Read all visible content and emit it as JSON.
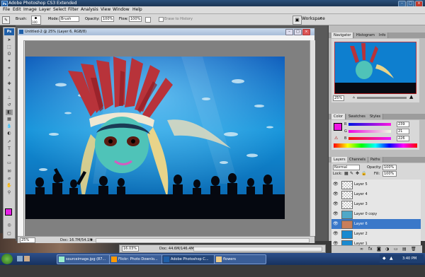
{
  "window": {
    "title": "Adobe Photoshop CS3 Extended"
  },
  "menu": [
    "File",
    "Edit",
    "Image",
    "Layer",
    "Select",
    "Filter",
    "Analysis",
    "View",
    "Window",
    "Help"
  ],
  "options": {
    "brush_label": "Brush:",
    "brush_size": "100",
    "mode_label": "Mode:",
    "mode_value": "Brush",
    "opacity_label": "Opacity:",
    "opacity_value": "100%",
    "flow_label": "Flow:",
    "flow_value": "100%",
    "erase_history": "Erase to History",
    "workspace": "Workspace"
  },
  "document": {
    "title": "Untitled-2 @ 25% (Layer 6, RGB/8)",
    "zoom": "25%",
    "doc_info": "Doc: 16.7M/54.1M"
  },
  "document2": {
    "zoom": "16.03%",
    "doc_info": "Doc: 44.6M/146.4M"
  },
  "navigator": {
    "tabs": [
      "Navigator",
      "Histogram",
      "Info"
    ],
    "zoom": "25%"
  },
  "color": {
    "tabs": [
      "Color",
      "Swatches",
      "Styles"
    ],
    "r": "239",
    "g": "21",
    "b": "226",
    "swatch": "#ef15e2"
  },
  "layers": {
    "tabs": [
      "Layers",
      "Channels",
      "Paths"
    ],
    "blend_mode": "Normal",
    "opacity_label": "Opacity:",
    "opacity": "100%",
    "lock_label": "Lock:",
    "fill_label": "Fill:",
    "fill": "100%",
    "items": [
      {
        "name": "Layer 5",
        "selected": false
      },
      {
        "name": "Layer 4",
        "selected": false
      },
      {
        "name": "Layer 3",
        "selected": false
      },
      {
        "name": "Layer 0 copy",
        "selected": false
      },
      {
        "name": "Layer 6",
        "selected": true
      },
      {
        "name": "Layer 2",
        "selected": false
      },
      {
        "name": "Layer 1",
        "selected": false
      }
    ]
  },
  "taskbar": {
    "items": [
      "sourceimage.jpg (87...",
      "Flickr: Photo Downlo...",
      "Adobe Photoshop C...",
      "flowers"
    ],
    "clock": "3:40 PM"
  },
  "toolbox": {
    "fg_color": "#e61ee6",
    "label": "Ps"
  }
}
